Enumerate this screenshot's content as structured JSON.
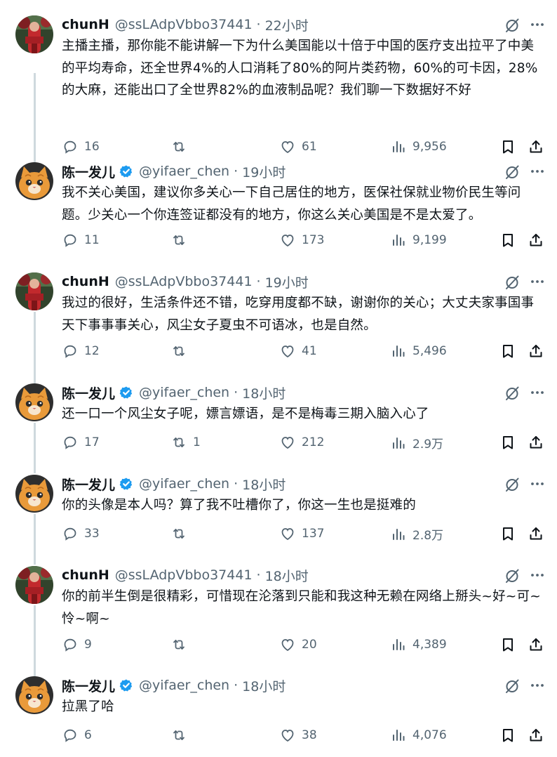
{
  "tweets": [
    {
      "name": "chunH",
      "handle": "@ssLAdpVbbo37441",
      "dot": "·",
      "time": "22小时",
      "verified": false,
      "avatar": "red",
      "text": "主播主播，那你能不能讲解一下为什么美国能以十倍于中国的医疗支出拉平了中美的平均寿命，还全世界4%的人口消耗了80%的阿片类药物，60%的可卡因，28%的大麻，还能出口了全世界82%的血液制品呢？我们聊一下数据好不好",
      "replies": "16",
      "retweets": "",
      "likes": "61",
      "views": "9,956"
    },
    {
      "name": "陈一发儿",
      "handle": "@yifaer_chen",
      "dot": "·",
      "time": "19小时",
      "verified": true,
      "avatar": "cat",
      "text": "我不关心美国，建议你多关心一下自己居住的地方，医保社保就业物价民生等问题。少关心一个你连签证都没有的地方，你这么关心美国是不是太爱了。",
      "replies": "11",
      "retweets": "",
      "likes": "173",
      "views": "9,199"
    },
    {
      "name": "chunH",
      "handle": "@ssLAdpVbbo37441",
      "dot": "·",
      "time": "19小时",
      "verified": false,
      "avatar": "red",
      "text": "我过的很好，生活条件还不错，吃穿用度都不缺，谢谢你的关心；大丈夫家事国事天下事事事关心，风尘女子夏虫不可语冰，也是自然。",
      "replies": "12",
      "retweets": "",
      "likes": "41",
      "views": "5,496"
    },
    {
      "name": "陈一发儿",
      "handle": "@yifaer_chen",
      "dot": "·",
      "time": "18小时",
      "verified": true,
      "avatar": "cat",
      "text": "还一口一个风尘女子呢，嫖言嫖语，是不是梅毒三期入脑入心了",
      "replies": "17",
      "retweets": "1",
      "likes": "212",
      "views": "2.9万"
    },
    {
      "name": "陈一发儿",
      "handle": "@yifaer_chen",
      "dot": "·",
      "time": "18小时",
      "verified": true,
      "avatar": "cat",
      "text": "你的头像是本人吗？算了我不吐槽你了，你这一生也是挺难的",
      "replies": "33",
      "retweets": "",
      "likes": "137",
      "views": "2.8万"
    },
    {
      "name": "chunH",
      "handle": "@ssLAdpVbbo37441",
      "dot": "·",
      "time": "18小时",
      "verified": false,
      "avatar": "red",
      "text": "你的前半生倒是很精彩，可惜现在沦落到只能和我这种无赖在网络上掰头~好~可~怜~啊~",
      "replies": "9",
      "retweets": "",
      "likes": "20",
      "views": "4,389"
    },
    {
      "name": "陈一发儿",
      "handle": "@yifaer_chen",
      "dot": "·",
      "time": "18小时",
      "verified": true,
      "avatar": "cat",
      "text": "拉黑了哈",
      "replies": "6",
      "retweets": "",
      "likes": "38",
      "views": "4,076"
    }
  ],
  "icons": {
    "reply": "reply-icon",
    "retweet": "retweet-icon",
    "like": "heart-icon",
    "views": "views-icon",
    "bookmark": "bookmark-icon",
    "share": "share-icon",
    "grok": "grok-icon",
    "more": "more-icon",
    "verified": "verified-badge-icon"
  },
  "colors": {
    "text": "#0f1419",
    "muted": "#536471",
    "verified": "#1d9bf0",
    "thread_line": "#cfd9de"
  }
}
